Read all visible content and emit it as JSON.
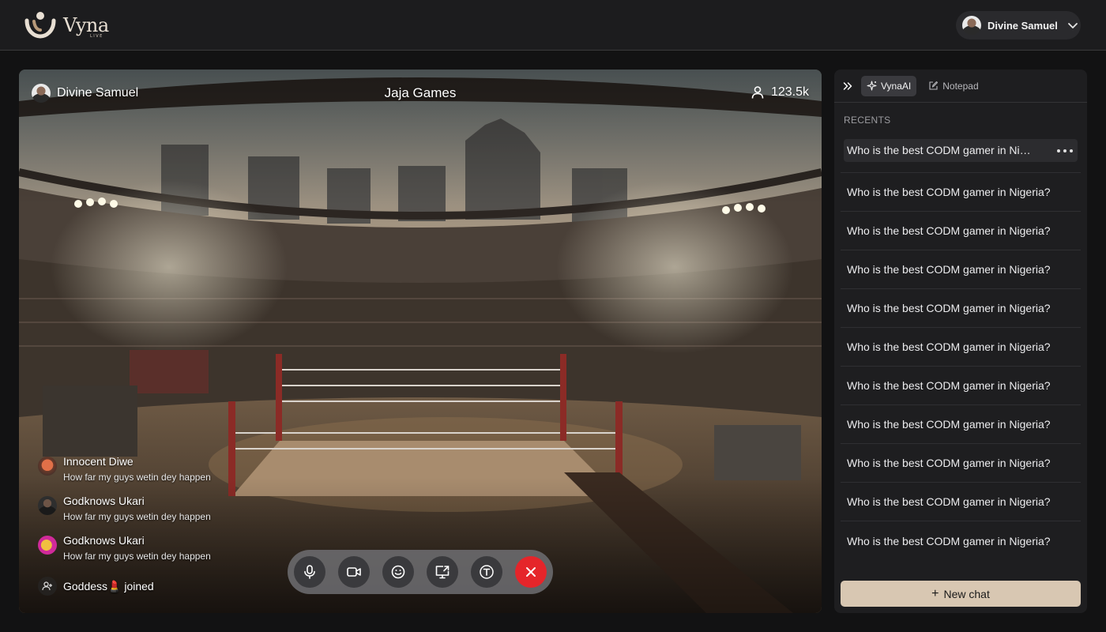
{
  "header": {
    "logo_text": "Vyna",
    "logo_sub": "LIVE",
    "user_name": "Divine Samuel"
  },
  "stream": {
    "host_name": "Divine Samuel",
    "title": "Jaja Games",
    "viewer_count": "123.5k"
  },
  "chat": [
    {
      "name": "Innocent Diwe",
      "text": "How far my guys wetin dey happen"
    },
    {
      "name": "Godknows Ukari",
      "text": "How far my guys wetin dey happen"
    },
    {
      "name": "Godknows Ukari",
      "text": "How far my guys wetin dey happen"
    }
  ],
  "join_event": {
    "text": "Goddess💄 joined"
  },
  "controls": [
    "microphone-icon",
    "video-camera-icon",
    "emoji-icon",
    "screen-share-icon",
    "text-icon",
    "end-call-icon"
  ],
  "panel": {
    "tabs": [
      {
        "label": "VynaAI",
        "active": true
      },
      {
        "label": "Notepad",
        "active": false
      }
    ],
    "recents_label": "RECENTS",
    "recents": [
      "Who is the best CODM gamer in Nigeria?",
      "Who is the best CODM gamer in Nigeria?",
      "Who is the best CODM gamer in Nigeria?",
      "Who is the best CODM gamer in Nigeria?",
      "Who is the best CODM gamer in Nigeria?",
      "Who is the best CODM gamer in Nigeria?",
      "Who is the best CODM gamer in Nigeria?",
      "Who is the best CODM gamer in Nigeria?",
      "Who is the best CODM gamer in Nigeria?",
      "Who is the best CODM gamer in Nigeria?",
      "Who is the best CODM gamer in Nigeria?"
    ],
    "new_chat_label": "New chat"
  },
  "colors": {
    "background": "#121213",
    "accent": "#d8c7b2",
    "end_call": "#e5252a"
  }
}
